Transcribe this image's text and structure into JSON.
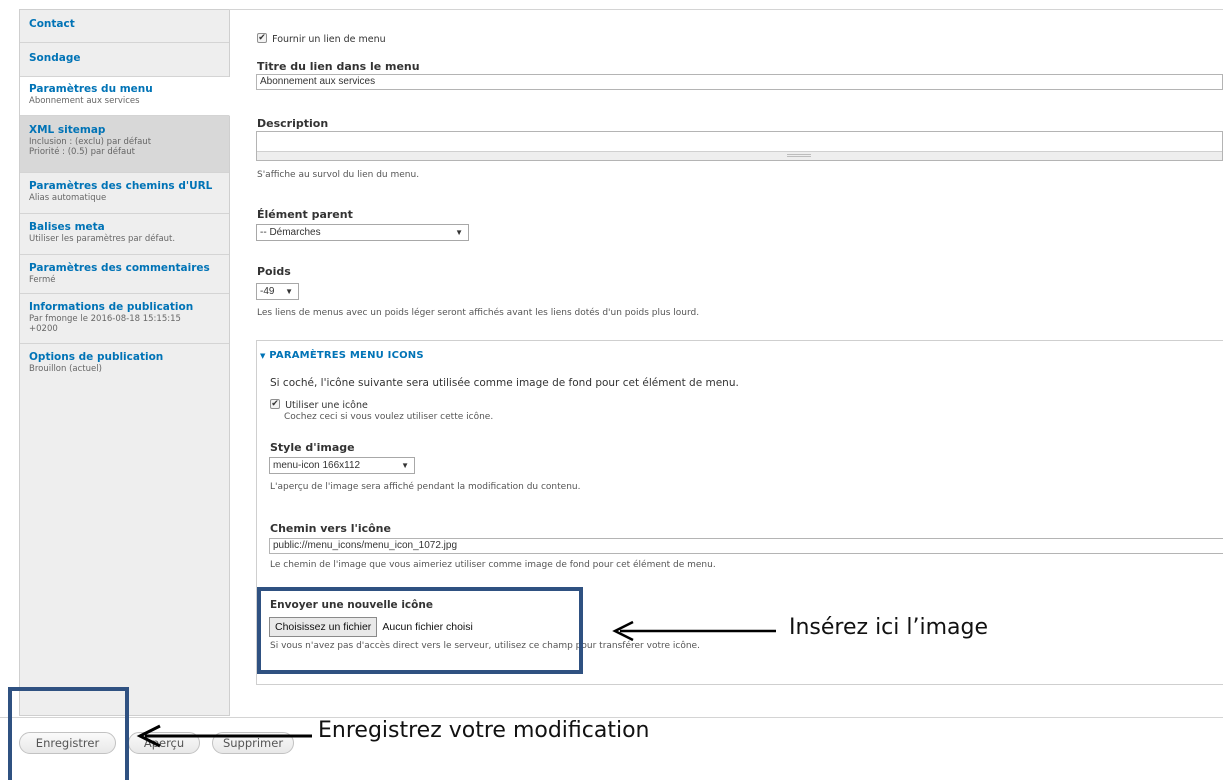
{
  "sidebar": {
    "tabs": [
      {
        "title": "Contact",
        "summary": ""
      },
      {
        "title": "Sondage",
        "summary": ""
      },
      {
        "title": "Paramètres du menu",
        "summary": "Abonnement aux services"
      },
      {
        "title": "XML sitemap",
        "summary": "Inclusion : (exclu) par défaut",
        "summary2": "Priorité : (0.5) par défaut"
      },
      {
        "title": "Paramètres des chemins d'URL",
        "summary": "Alias automatique"
      },
      {
        "title": "Balises meta",
        "summary": "Utiliser les paramètres par défaut."
      },
      {
        "title": "Paramètres des commentaires",
        "summary": "Fermé"
      },
      {
        "title": "Informations de publication",
        "summary": "Par fmonge le 2016-08-18 15:15:15",
        "summary2": "+0200"
      },
      {
        "title": "Options de publication",
        "summary": "Brouillon (actuel)"
      }
    ]
  },
  "form": {
    "provide_menu_link": {
      "label": "Fournir un lien de menu",
      "checked": true
    },
    "menu_link_title": {
      "label": "Titre du lien dans le menu",
      "value": "Abonnement aux services"
    },
    "description": {
      "label": "Description",
      "value": "",
      "help": "S'affiche au survol du lien du menu."
    },
    "parent": {
      "label": "Élément parent",
      "value": "-- Démarches"
    },
    "weight": {
      "label": "Poids",
      "value": "-49",
      "help": "Les liens de menus avec un poids léger seront affichés avant les liens dotés d'un poids plus lourd."
    },
    "menu_icons": {
      "legend": "PARAMÈTRES MENU ICONS",
      "intro": "Si coché, l'icône suivante sera utilisée comme image de fond pour cet élément de menu.",
      "use_icon": {
        "label": "Utiliser une icône",
        "checked": true,
        "help": "Cochez ceci si vous voulez utiliser cette icône."
      },
      "image_style": {
        "label": "Style d'image",
        "value": "menu-icon 166x112",
        "help": "L'aperçu de l'image sera affiché pendant la modification du contenu."
      },
      "icon_path": {
        "label": "Chemin vers l'icône",
        "value": "public://menu_icons/menu_icon_1072.jpg",
        "help": "Le chemin de l'image que vous aimeriez utiliser comme image de fond pour cet élément de menu."
      },
      "upload": {
        "label": "Envoyer une nouvelle icône",
        "button": "Choisissez un fichier",
        "status": "Aucun fichier choisi",
        "help": "Si vous n'avez pas d'accès direct vers le serveur, utilisez ce champ pour transférer votre icône."
      }
    }
  },
  "actions": {
    "save": "Enregistrer",
    "preview": "Aperçu",
    "delete": "Supprimer"
  },
  "annotations": {
    "insert_image": "Insérez ici l’image",
    "save_change": "Enregistrez votre modification"
  },
  "colors": {
    "link": "#0073b6",
    "callout": "#2f5181"
  }
}
